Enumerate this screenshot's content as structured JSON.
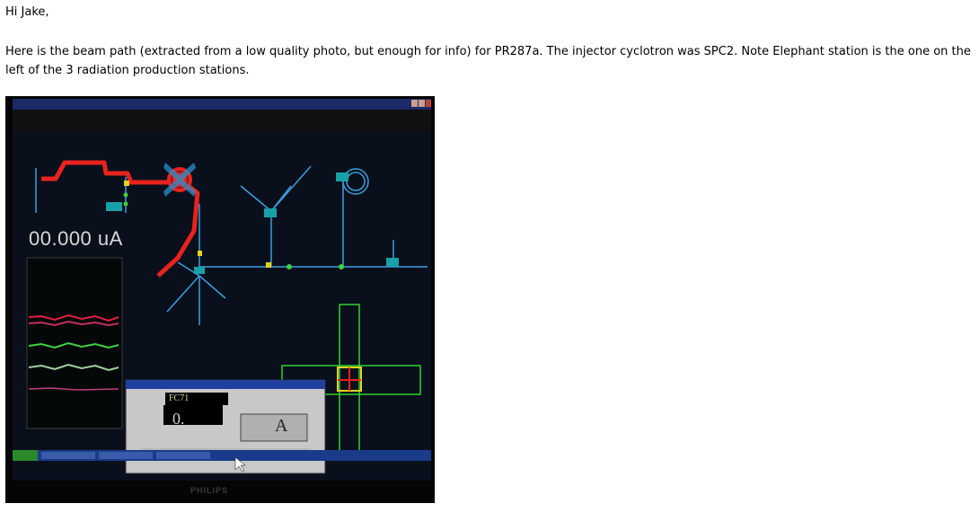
{
  "email": {
    "greeting": "Hi Jake,",
    "body": "Here is the beam path (extracted from a low quality photo, but enough for info) for PR287a. The injector cyclotron was SPC2. Note Elephant station is the one on the left of the 3 radiation production stations."
  },
  "photo": {
    "current_readout": "00.000 uA",
    "dialog_channel": "FC71",
    "dialog_value": "0.",
    "dialog_unit": "A",
    "monitor_brand": "PHILIPS"
  },
  "colors": {
    "beam_path": "#e8231e",
    "beamline": "#3aa0dc",
    "monitor_frame": "#050505",
    "screen_bg": "#0a0f1c",
    "trace_green": "#40d040"
  },
  "icons": [
    "close-icon",
    "maximize-icon",
    "minimize-icon",
    "cursor-icon"
  ]
}
